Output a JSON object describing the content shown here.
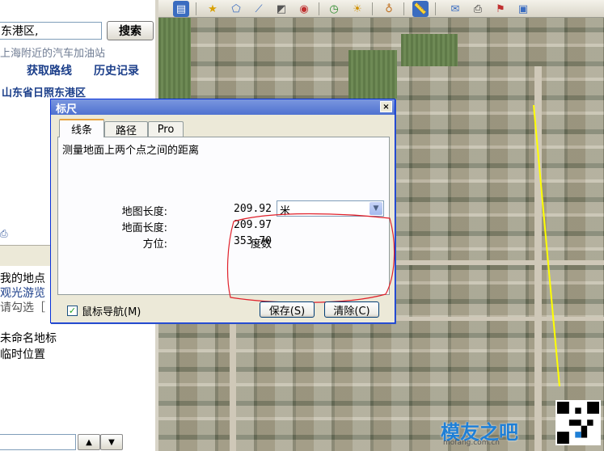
{
  "left_panel": {
    "search_value": "东港区,",
    "search_button": "搜索",
    "search_hint": "上海附近的汽车加油站",
    "get_route": "获取路线",
    "history": "历史记录",
    "result_title": "山东省日照东港区",
    "places": {
      "line1": "我的地点",
      "line2": "观光游览",
      "line3": "请勾选［",
      "line4": "未命名地标",
      "line5": "临时位置"
    }
  },
  "dialog": {
    "title": "标尺",
    "close_glyph": "×",
    "tabs": [
      {
        "label": "线条"
      },
      {
        "label": "路径"
      },
      {
        "label": "Pro"
      }
    ],
    "description": "测量地面上两个点之间的距离",
    "map_length_label": "地图长度:",
    "map_length_value": "209.92",
    "unit_value": "米",
    "ground_length_label": "地面长度:",
    "ground_length_value": "209.97",
    "bearing_label": "方位:",
    "bearing_value": "353.70",
    "bearing_unit": "度数",
    "mouse_nav_label": "鼠标导航(M)",
    "mouse_nav_checked": true,
    "save_button": "保存(S)",
    "clear_button": "清除(C)"
  },
  "watermark": {
    "text": "模友之吧",
    "sub": "mofang.com.cn"
  },
  "colors": {
    "annotation": "#e0202a",
    "measure_line": "#ffff00",
    "title_bar": "#4f72d0",
    "link_blue": "#1c3f8a"
  }
}
